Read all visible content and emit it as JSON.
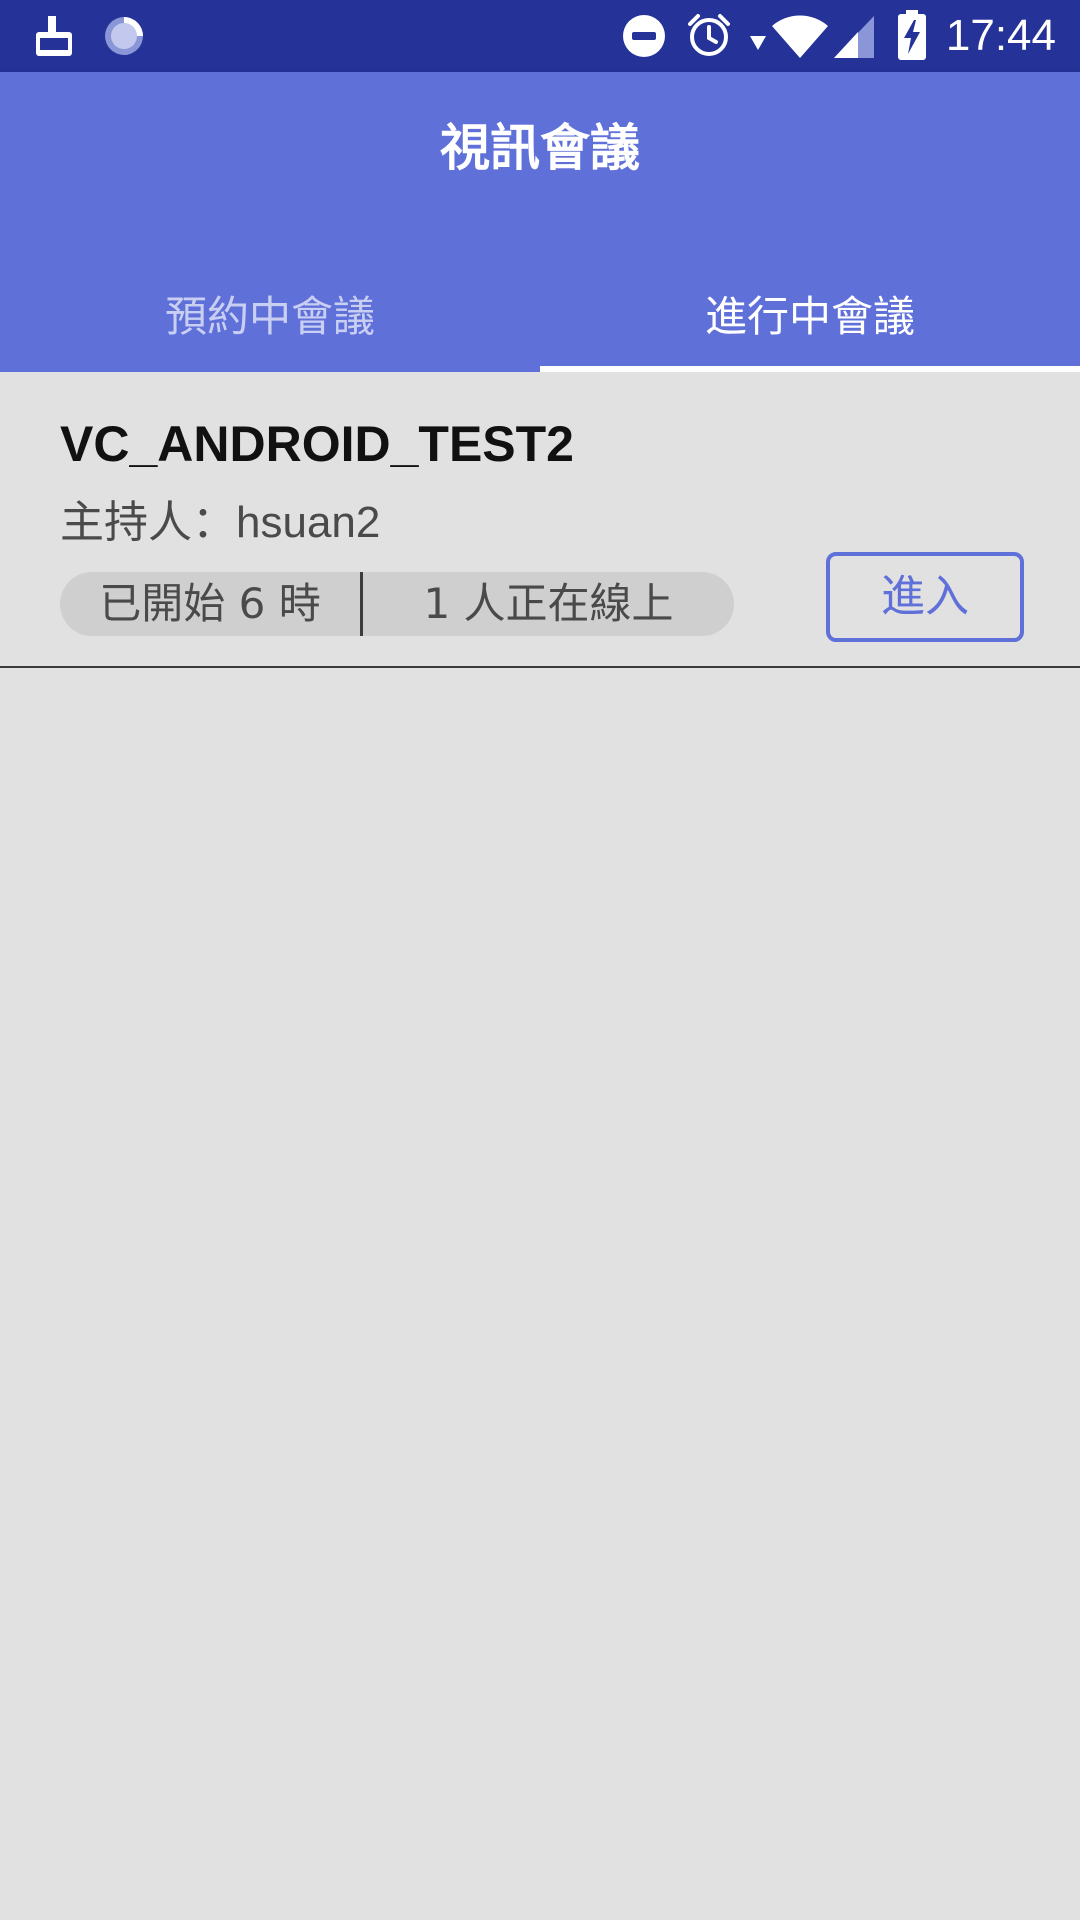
{
  "status_bar": {
    "time": "17:44",
    "icons": [
      "clean-app-icon",
      "loading-spinner-icon",
      "do-not-disturb-icon",
      "alarm-icon",
      "wifi-icon",
      "signal-icon",
      "battery-charging-icon"
    ]
  },
  "app_bar": {
    "title": "視訊會議",
    "tabs": [
      {
        "label": "預約中會議",
        "active": false
      },
      {
        "label": "進行中會議",
        "active": true
      }
    ]
  },
  "meetings": [
    {
      "name": "VC_ANDROID_TEST2",
      "host_label": "主持人：",
      "host_name": "hsuan2",
      "started_text": "已開始 6 時",
      "online_text": "1  人正在線上",
      "enter_label": "進入"
    }
  ],
  "colors": {
    "status_bar": "#253399",
    "primary": "#5f70d9",
    "background": "#e1e1e1",
    "pill": "#cfcfcf"
  }
}
